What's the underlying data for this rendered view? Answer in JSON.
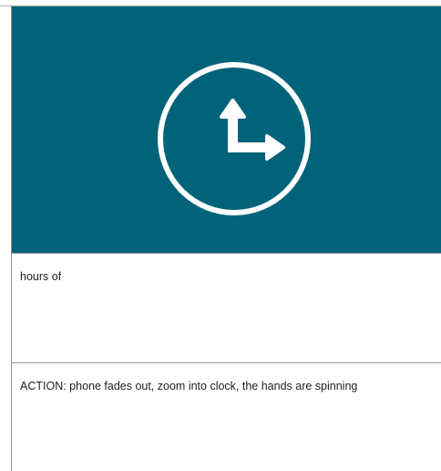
{
  "storyboard": {
    "panel": {
      "image": {
        "background_color": "#00637a",
        "icon": "clock-arrow-icon",
        "icon_color": "#ffffff"
      },
      "narration_text": "hours of",
      "action_text": "ACTION: phone fades out, zoom into clock, the hands are spinning"
    }
  }
}
